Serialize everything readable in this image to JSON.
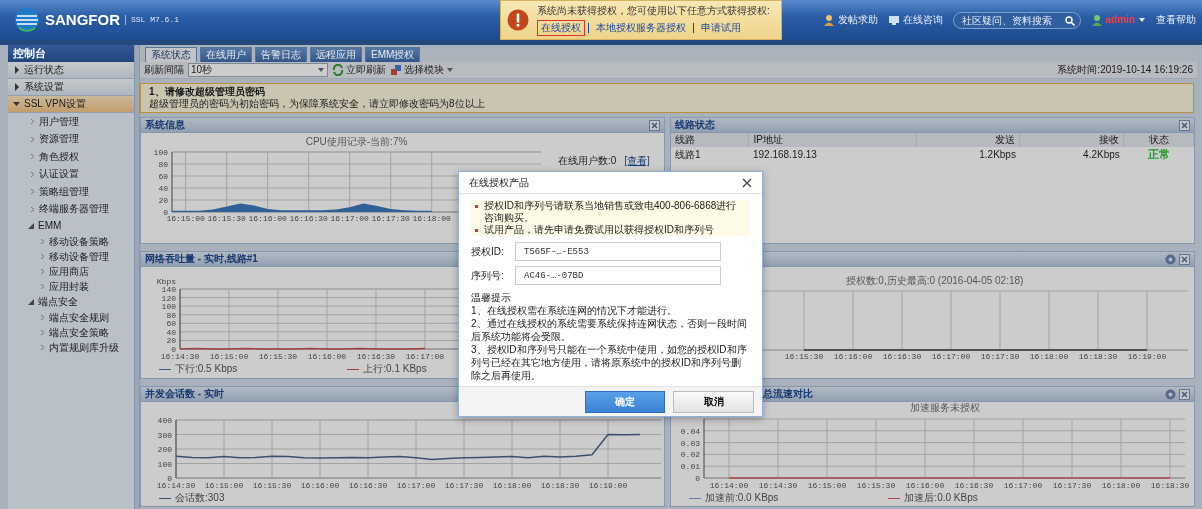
{
  "header": {
    "logo": "SANGFOR",
    "version": "SSL M7.6.1",
    "notice": {
      "message": "系统尚未获得授权，您可使用以下任意方式获得授权:",
      "links": [
        {
          "label": "在线授权",
          "selected": true
        },
        {
          "label": "本地授权服务器授权",
          "selected": false
        },
        {
          "label": "申请试用",
          "selected": false
        }
      ]
    },
    "actions": [
      {
        "kind": "link",
        "label": "发帖求助"
      },
      {
        "kind": "link",
        "label": "在线咨询"
      },
      {
        "kind": "search",
        "placeholder": "社区疑问、资料搜索"
      },
      {
        "kind": "user",
        "label": "admin"
      },
      {
        "kind": "plain",
        "label": "查看帮助"
      }
    ]
  },
  "sidebar": {
    "title": "控制台",
    "items": [
      {
        "label": "运行状态",
        "expanded": false,
        "selected": false
      },
      {
        "label": "系统设置",
        "expanded": false,
        "selected": false
      },
      {
        "label": "SSL VPN设置",
        "expanded": true,
        "selected": true,
        "children": [
          {
            "label": "用户管理"
          },
          {
            "label": "资源管理"
          },
          {
            "label": "角色授权"
          },
          {
            "label": "认证设置"
          },
          {
            "label": "策略组管理"
          },
          {
            "label": "终端服务器管理"
          },
          {
            "label": "EMM",
            "expanded": true,
            "children": [
              {
                "label": "移动设备策略"
              },
              {
                "label": "移动设备管理"
              },
              {
                "label": "应用商店"
              },
              {
                "label": "应用封装"
              }
            ]
          },
          {
            "label": "端点安全",
            "expanded": true,
            "children": [
              {
                "label": "端点安全规则"
              },
              {
                "label": "端点安全策略"
              },
              {
                "label": "内置规则库升级"
              }
            ]
          }
        ]
      }
    ]
  },
  "tabs": [
    {
      "label": "系统状态",
      "selected": true
    },
    {
      "label": "在线用户",
      "selected": false
    },
    {
      "label": "告警日志",
      "selected": false
    },
    {
      "label": "远程应用",
      "selected": false
    },
    {
      "label": "EMM授权",
      "selected": false
    }
  ],
  "toolbar": {
    "interval_label": "刷新间隔",
    "interval": "10秒",
    "refresh_button": "立即刷新",
    "module_button": "选择模块",
    "system_time": "系统时间:2019-10-14 16:19:26"
  },
  "notice": {
    "title": "1、请修改超级管理员密码",
    "text": "超级管理员的密码为初始密码，为保障系统安全，请立即修改密码为8位以上"
  },
  "panels": [
    {
      "kind": "system_info",
      "title": "系统信息",
      "closable": true,
      "settings": false,
      "stats": [
        {
          "label": "在线用户数:0",
          "link": "[查看]"
        }
      ],
      "chart_data": {
        "type": "area",
        "title": "CPU使用记录-当前:7%",
        "grid": true,
        "ylim": [
          0,
          100
        ],
        "yticks": [
          0,
          20,
          40,
          60,
          80,
          100
        ],
        "categories": [
          null,
          "16:15:00",
          null,
          null,
          "16:15:30",
          null,
          null,
          "16:16:00",
          null,
          null,
          "16:16:30",
          null,
          null,
          "16:17:00",
          null,
          null,
          "16:17:30",
          null,
          null,
          "16:18:00"
        ],
        "values": [
          2,
          2,
          2,
          4,
          9,
          14,
          11,
          5,
          3,
          3,
          3,
          3,
          4,
          8,
          14,
          10,
          5,
          3,
          2,
          2
        ]
      }
    },
    {
      "kind": "table",
      "title": "线路状态",
      "closable": true,
      "settings": false,
      "columns": [
        "线路",
        "IP地址",
        "发送",
        "接收",
        "状态"
      ],
      "rows": [
        {
          "cells": [
            "线路1",
            "192.168.19.13",
            "1.2Kbps",
            "4.2Kbps",
            "正常"
          ],
          "color": "#1f9a2a"
        }
      ]
    },
    {
      "kind": "chart",
      "title": "网络吞吐量 - 实时,线路#1",
      "closable": false,
      "settings": false,
      "chart_data": {
        "type": "line",
        "ylabel": "Kbps",
        "grid": true,
        "legend": "bottom",
        "ylim": [
          0,
          140
        ],
        "yticks": [
          0,
          20,
          40,
          60,
          80,
          100,
          120,
          140
        ],
        "categories": [
          "16:14:30",
          null,
          null,
          "16:15:00",
          null,
          null,
          "16:15:30",
          null,
          null,
          "16:16:00",
          null,
          null,
          "16:16:30",
          null,
          null,
          "16:17:00"
        ],
        "series": [
          {
            "name": "下行:0.5 Kbps",
            "color": "#3d5a8a",
            "values": [
              null,
              null,
              null,
              null,
              null,
              null,
              null,
              null,
              null,
              null,
              null,
              null,
              null,
              null,
              null,
              null
            ]
          },
          {
            "name": "上行:0.1 KBps",
            "color": "#a04040",
            "values": [
              0,
              1,
              0,
              0,
              1,
              0,
              0,
              0,
              1,
              0,
              0,
              1,
              0,
              0,
              0,
              1
            ]
          }
        ]
      }
    },
    {
      "kind": "plot",
      "closable": true,
      "settings": true,
      "plot_title": "授权数:0,历史最高:0 (2016-04-05 02:18)",
      "time_labels": [
        "16:15:30",
        "16:16:00",
        "16:16:30",
        "16:17:00",
        "16:17:30",
        "16:18:00",
        "16:18:30",
        "16:19:00"
      ]
    },
    {
      "kind": "chart",
      "title": "并发会话数 - 实时",
      "closable": false,
      "settings": false,
      "chart_data": {
        "type": "line",
        "grid": true,
        "legend": "bottom",
        "ylim": [
          0,
          400
        ],
        "yticks": [
          0,
          100,
          200,
          300,
          400
        ],
        "categories": [
          "16:14:30",
          null,
          null,
          "16:15:00",
          null,
          null,
          "16:15:30",
          null,
          null,
          "16:16:00",
          null,
          null,
          "16:16:30",
          null,
          null,
          "16:17:00",
          null,
          null,
          "16:17:30",
          null,
          null,
          "16:18:00",
          null,
          null,
          "16:18:30",
          null,
          null,
          "16:19:00",
          null,
          null
        ],
        "series": [
          {
            "name": "会话数:303",
            "color": "#3c4f6e",
            "values": [
              150,
              142,
              140,
              148,
              140,
              142,
              150,
              148,
              140,
              138,
              140,
              142,
              140,
              145,
              148,
              140,
              128,
              135,
              140,
              142,
              145,
              148,
              140,
              150,
              145,
              150,
              160,
              300,
              298,
              300
            ]
          }
        ]
      }
    },
    {
      "kind": "chart",
      "title": "总流速对比",
      "closable": true,
      "settings": true,
      "chart_data": {
        "type": "line",
        "title": "加速服务未授权",
        "grid": true,
        "legend": "bottom",
        "ylim": [
          0,
          0.05
        ],
        "yticks": [
          0,
          0.01,
          0.02,
          0.03,
          0.04
        ],
        "categories": [
          "16:14:00",
          "16:14:30",
          "16:15:00",
          "16:15:30",
          "16:16:00",
          "16:16:30",
          "16:17:00",
          "16:17:30",
          "16:18:00",
          "16:18:30"
        ],
        "series": [
          {
            "name": "加速前:0.0 KBps",
            "color": "#6a7fa8",
            "values": [
              null,
              null,
              null,
              null,
              null,
              null,
              null,
              null,
              null,
              null
            ]
          },
          {
            "name": "加速后:0.0 KBps",
            "color": "#b04a4a",
            "values": [
              0,
              0,
              0,
              0,
              0,
              0,
              0,
              0,
              0,
              0
            ]
          }
        ]
      }
    }
  ],
  "dialog": {
    "title": "在线授权产品",
    "notes": [
      "授权ID和序列号请联系当地销售或致电400-806-6868进行咨询购买。",
      "试用产品，请先申请免费试用以获得授权ID和序列号"
    ],
    "fields": [
      {
        "label": "授权ID:",
        "value": "T565F-…-E553"
      },
      {
        "label": "序列号:",
        "value": "AC46-…-07BD"
      }
    ],
    "tips_title": "温馨提示",
    "tips": [
      "1、在线授权需在系统连网的情况下才能进行。",
      "2、通过在线授权的系统需要系统保持连网状态，否则一段时间后系统功能将会受限。",
      "3、授权ID和序列号只能在一个系统中使用，如您的授权ID和序列号已经在其它地方使用，请将原系统中的授权ID和序列号删除之后再使用。"
    ],
    "buttons": [
      {
        "kind": "primary",
        "label": "确定"
      },
      {
        "kind": "secondary",
        "label": "取消"
      }
    ]
  }
}
